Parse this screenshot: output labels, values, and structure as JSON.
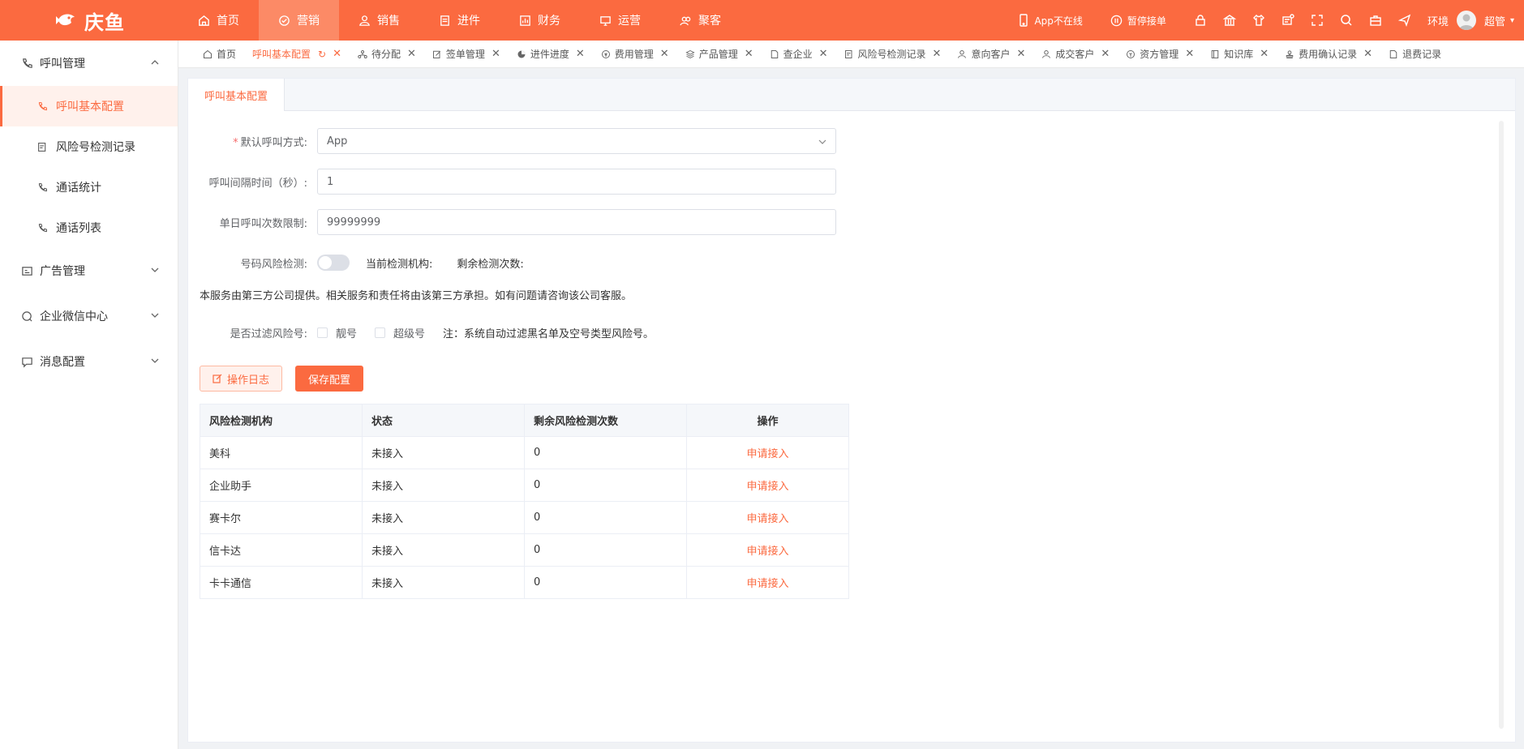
{
  "brand": {
    "name": "庆鱼",
    "color": "#fb6a40"
  },
  "topnav": [
    {
      "label": "首页",
      "icon": "home-icon"
    },
    {
      "label": "营销",
      "icon": "marketing-icon",
      "active": true
    },
    {
      "label": "销售",
      "icon": "sales-icon"
    },
    {
      "label": "进件",
      "icon": "document-icon"
    },
    {
      "label": "财务",
      "icon": "finance-icon"
    },
    {
      "label": "运营",
      "icon": "monitor-icon"
    },
    {
      "label": "聚客",
      "icon": "users-icon"
    }
  ],
  "topright": {
    "app_status": "App不在线",
    "pause": "暂停接单",
    "env": "环境",
    "user": "超管"
  },
  "sidebar": {
    "groups": [
      {
        "label": "呼叫管理",
        "icon": "phone-icon",
        "expanded": true
      },
      {
        "label": "广告管理",
        "icon": "ad-icon"
      },
      {
        "label": "企业微信中心",
        "icon": "chat-icon"
      },
      {
        "label": "消息配置",
        "icon": "message-icon"
      }
    ],
    "subitems": [
      {
        "label": "呼叫基本配置",
        "active": true
      },
      {
        "label": "风险号检测记录"
      },
      {
        "label": "通话统计"
      },
      {
        "label": "通话列表"
      }
    ]
  },
  "tabs": [
    {
      "label": "首页"
    },
    {
      "label": "呼叫基本配置",
      "active": true
    },
    {
      "label": "待分配"
    },
    {
      "label": "签单管理"
    },
    {
      "label": "进件进度"
    },
    {
      "label": "费用管理"
    },
    {
      "label": "产品管理"
    },
    {
      "label": "查企业"
    },
    {
      "label": "风险号检测记录"
    },
    {
      "label": "意向客户"
    },
    {
      "label": "成交客户"
    },
    {
      "label": "资方管理"
    },
    {
      "label": "知识库"
    },
    {
      "label": "费用确认记录"
    },
    {
      "label": "退费记录"
    }
  ],
  "panel": {
    "tab_label": "呼叫基本配置"
  },
  "form": {
    "call_mode": {
      "label": "默认呼叫方式:",
      "value": "App"
    },
    "interval": {
      "label": "呼叫间隔时间（秒）:",
      "value": "1"
    },
    "daily_limit": {
      "label": "单日呼叫次数限制:",
      "value": "99999999"
    },
    "risk_check": {
      "label": "号码风险检测:",
      "enabled": false,
      "current_org": "当前检测机构:",
      "remaining": "剩余检测次数:"
    },
    "notice": "本服务由第三方公司提供。相关服务和责任将由该第三方承担。如有问题请咨询该公司客服。",
    "filter": {
      "label": "是否过滤风险号:",
      "options": [
        "靓号",
        "超级号"
      ],
      "note": "注：系统自动过滤黑名单及空号类型风险号。"
    }
  },
  "buttons": {
    "log": "操作日志",
    "save": "保存配置"
  },
  "table": {
    "headers": [
      "风险检测机构",
      "状态",
      "剩余风险检测次数",
      "操作"
    ],
    "rows": [
      [
        "美科",
        "未接入",
        "0",
        "申请接入"
      ],
      [
        "企业助手",
        "未接入",
        "0",
        "申请接入"
      ],
      [
        "赛卡尔",
        "未接入",
        "0",
        "申请接入"
      ],
      [
        "信卡达",
        "未接入",
        "0",
        "申请接入"
      ],
      [
        "卡卡通信",
        "未接入",
        "0",
        "申请接入"
      ]
    ]
  }
}
